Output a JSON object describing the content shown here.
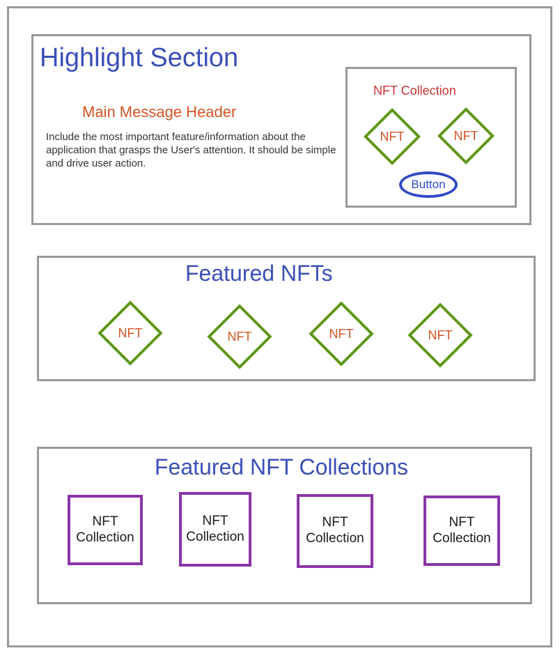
{
  "highlight": {
    "title": "Highlight Section",
    "main_header": "Main Message Header",
    "main_body": "Include the most important feature/information about the application that grasps the User's attention. It should be simple and drive user action.",
    "collection_panel": {
      "label": "NFT Collection",
      "nfts": [
        "NFT",
        "NFT"
      ],
      "button_label": "Button"
    }
  },
  "featured_nfts": {
    "title": "Featured NFTs",
    "items": [
      "NFT",
      "NFT",
      "NFT",
      "NFT"
    ]
  },
  "featured_collections": {
    "title": "Featured NFT Collections",
    "items": [
      {
        "line1": "NFT",
        "line2": "Collection"
      },
      {
        "line1": "NFT",
        "line2": "Collection"
      },
      {
        "line1": "NFT",
        "line2": "Collection"
      },
      {
        "line1": "NFT",
        "line2": "Collection"
      }
    ]
  },
  "colors": {
    "title_blue": "#3b4fb8",
    "header_orange": "#d55422",
    "panel_label_red": "#cc3333",
    "button_blue": "#3049c4",
    "nft_green": "#5e9718",
    "collection_purple": "#8a35a8",
    "frame_gray": "#999999"
  }
}
